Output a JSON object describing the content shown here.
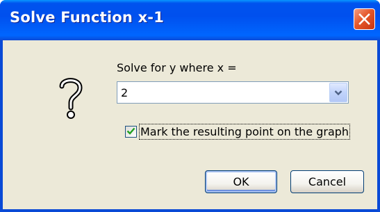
{
  "dialog": {
    "title": "Solve Function x-1",
    "close_icon": "close-icon",
    "prompt_icon": "question-icon"
  },
  "form": {
    "prompt_label": "Solve for y where x =",
    "x_value": "2",
    "dropdown_icon": "chevron-down-icon",
    "mark_point_label": "Mark the resulting point on the graph",
    "mark_point_checked": true
  },
  "buttons": {
    "ok_label": "OK",
    "cancel_label": "Cancel"
  },
  "colors": {
    "titlebar": "#0053ee",
    "dialog_background": "#ece9d8",
    "close_button": "#e5582b",
    "check_mark": "#21a121"
  }
}
